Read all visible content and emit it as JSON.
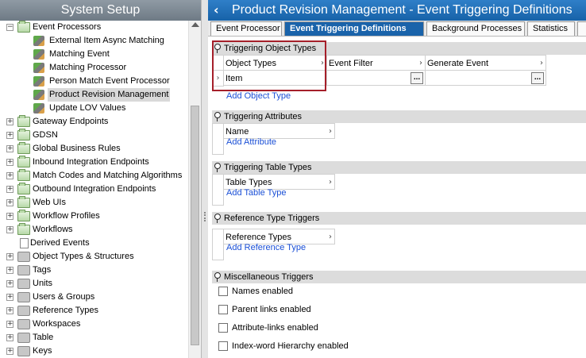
{
  "left_panel": {
    "title": "System Setup",
    "tree": [
      {
        "label": "Event Processors",
        "icon": "folder-icon",
        "indent": 0,
        "expander": "−"
      },
      {
        "label": "External Item Async Matching",
        "icon": "event-processor-icon",
        "indent": 1,
        "expander": ""
      },
      {
        "label": "Matching Event",
        "icon": "event-processor-icon",
        "indent": 1,
        "expander": ""
      },
      {
        "label": "Matching Processor",
        "icon": "event-processor-icon",
        "indent": 1,
        "expander": ""
      },
      {
        "label": "Person Match Event Processor",
        "icon": "event-processor-icon",
        "indent": 1,
        "expander": ""
      },
      {
        "label": "Product Revision Management",
        "icon": "event-processor-icon",
        "indent": 1,
        "expander": "",
        "selected": true
      },
      {
        "label": "Update LOV Values",
        "icon": "event-processor-icon",
        "indent": 1,
        "expander": ""
      },
      {
        "label": "Gateway Endpoints",
        "icon": "folder-icon",
        "indent": 0,
        "expander": "+"
      },
      {
        "label": "GDSN",
        "icon": "folder-icon",
        "indent": 0,
        "expander": "+"
      },
      {
        "label": "Global Business Rules",
        "icon": "folder-icon",
        "indent": 0,
        "expander": "+"
      },
      {
        "label": "Inbound Integration Endpoints",
        "icon": "folder-icon",
        "indent": 0,
        "expander": "+"
      },
      {
        "label": "Match Codes and Matching Algorithms",
        "icon": "folder-icon",
        "indent": 0,
        "expander": "+"
      },
      {
        "label": "Outbound Integration Endpoints",
        "icon": "folder-icon",
        "indent": 0,
        "expander": "+"
      },
      {
        "label": "Web UIs",
        "icon": "folder-icon",
        "indent": 0,
        "expander": "+"
      },
      {
        "label": "Workflow Profiles",
        "icon": "folder-icon",
        "indent": 0,
        "expander": "+"
      },
      {
        "label": "Workflows",
        "icon": "folder-icon",
        "indent": 0,
        "expander": "+"
      },
      {
        "label": "Derived Events",
        "icon": "document-icon",
        "indent": 0,
        "expander": ""
      },
      {
        "label": "Object Types & Structures",
        "icon": "object-types-icon",
        "indent": 0,
        "expander": "+"
      },
      {
        "label": "Tags",
        "icon": "tags-icon",
        "indent": 0,
        "expander": "+"
      },
      {
        "label": "Units",
        "icon": "units-icon",
        "indent": 0,
        "expander": "+"
      },
      {
        "label": "Users & Groups",
        "icon": "users-icon",
        "indent": 0,
        "expander": "+"
      },
      {
        "label": "Reference Types",
        "icon": "reference-types-icon",
        "indent": 0,
        "expander": "+"
      },
      {
        "label": "Workspaces",
        "icon": "workspaces-icon",
        "indent": 0,
        "expander": "+"
      },
      {
        "label": "Table",
        "icon": "table-icon",
        "indent": 0,
        "expander": "+"
      },
      {
        "label": "Keys",
        "icon": "keys-icon",
        "indent": 0,
        "expander": "+"
      }
    ]
  },
  "right_panel": {
    "title": "Product Revision Management - Event Triggering Definitions",
    "tabs": [
      {
        "label": "Event Processor",
        "active": false
      },
      {
        "label": "Event Triggering Definitions",
        "active": true
      },
      {
        "label": "Background Processes",
        "active": false
      },
      {
        "label": "Statistics",
        "active": false
      }
    ],
    "sections": {
      "triggering_object_types": {
        "title": "Triggering Object Types",
        "columns": [
          "Object Types",
          "Event Filter",
          "Generate Event"
        ],
        "row_value": "Item",
        "ellipsis": "...",
        "add_link": "Add Object Type"
      },
      "triggering_attributes": {
        "title": "Triggering Attributes",
        "columns": [
          "Name"
        ],
        "add_link": "Add Attribute"
      },
      "triggering_table_types": {
        "title": "Triggering Table Types",
        "columns": [
          "Table Types"
        ],
        "add_link": "Add Table Type"
      },
      "reference_type_triggers": {
        "title": "Reference Type Triggers",
        "columns": [
          "Reference Types"
        ],
        "add_link": "Add Reference Type"
      },
      "miscellaneous_triggers": {
        "title": "Miscellaneous Triggers",
        "checkboxes": [
          {
            "label": "Names enabled",
            "checked": false
          },
          {
            "label": "Parent links enabled",
            "checked": false
          },
          {
            "label": "Attribute-links enabled",
            "checked": false
          },
          {
            "label": "Index-word Hierarchy enabled",
            "checked": false
          }
        ]
      }
    }
  },
  "colors": {
    "right_header": "#1762a8",
    "left_header": "#6e7a85",
    "active_tab": "#1a63aa",
    "link": "#1a4fd6",
    "highlight": "#a51f2a"
  }
}
